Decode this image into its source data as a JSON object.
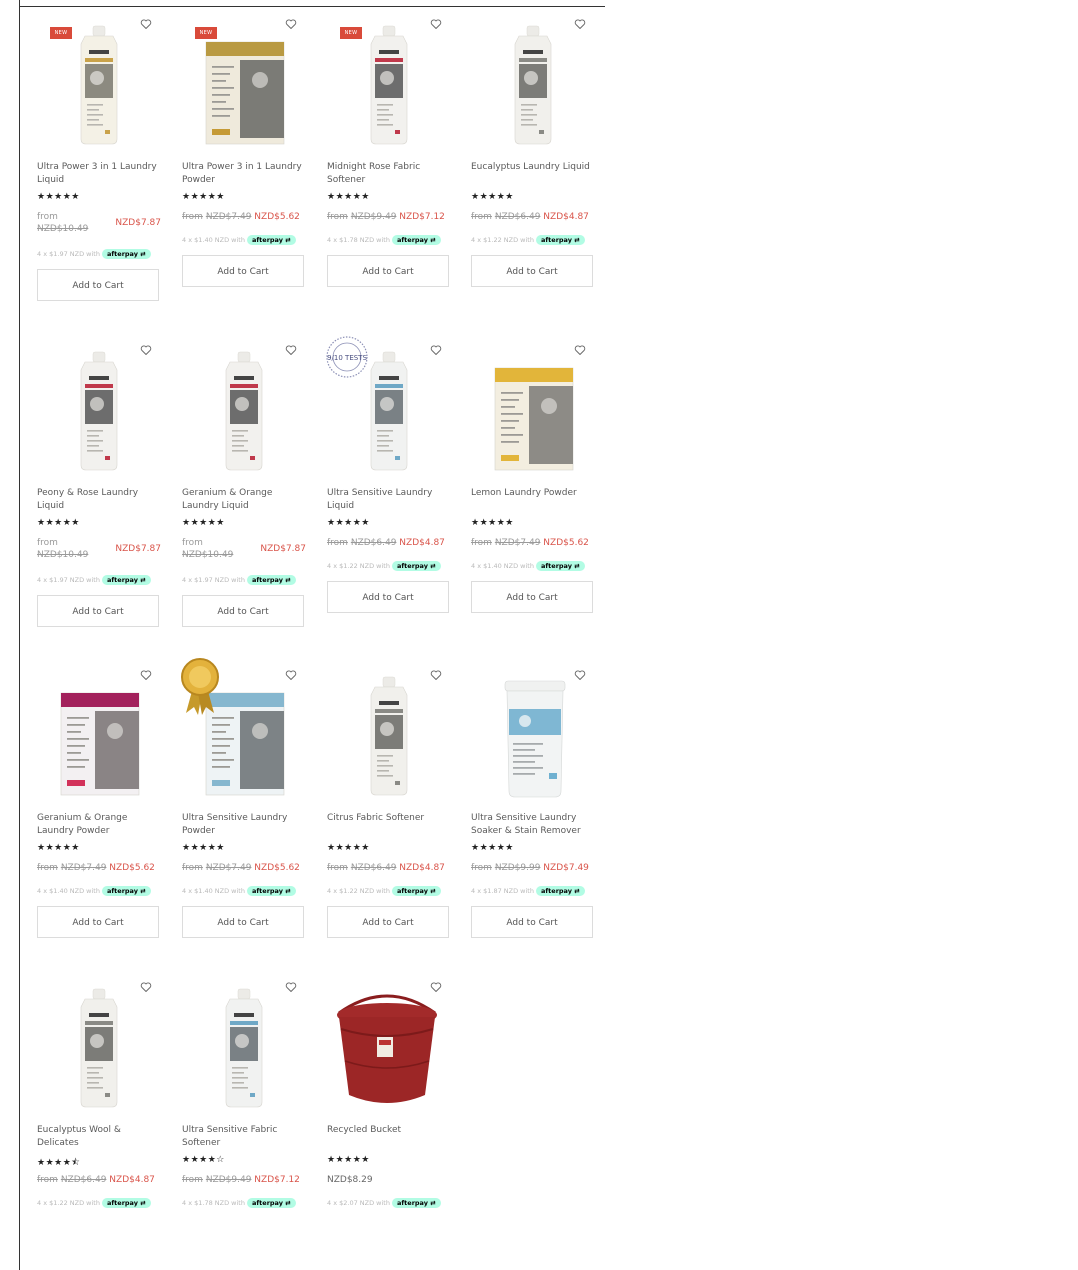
{
  "ui": {
    "add_to_cart_label": "Add to Cart",
    "new_badge": "NEW",
    "afterpay_label": "afterpay"
  },
  "products": [
    {
      "title": "Ultra Power 3 in 1 Laundry Liquid",
      "stars": "★★★★★",
      "from": "from",
      "old_price": "NZD$10.49",
      "price": "NZD$7.87",
      "installment": "4 x $1.97 NZD with",
      "new": true,
      "image": "bottle-gold",
      "price_layout": "stacked"
    },
    {
      "title": "Ultra Power 3 in 1 Laundry Powder",
      "stars": "★★★★★",
      "from": "from",
      "old_price": "NZD$7.49",
      "price": "NZD$5.62",
      "installment": "4 x $1.40 NZD with",
      "new": true,
      "image": "box-gold",
      "price_layout": "inline"
    },
    {
      "title": "Midnight Rose Fabric Softener",
      "stars": "★★★★★",
      "from": "from",
      "old_price": "NZD$9.49",
      "price": "NZD$7.12",
      "installment": "4 x $1.78 NZD with",
      "new": true,
      "image": "bottle-red",
      "price_layout": "inline"
    },
    {
      "title": "Eucalyptus Laundry Liquid",
      "stars": "★★★★★",
      "from": "from",
      "old_price": "NZD$6.49",
      "price": "NZD$4.87",
      "installment": "4 x $1.22 NZD with",
      "new": false,
      "image": "bottle-grey",
      "price_layout": "inline"
    },
    {
      "title": "Peony & Rose Laundry Liquid",
      "stars": "★★★★★",
      "from": "from",
      "old_price": "NZD$10.49",
      "price": "NZD$7.87",
      "installment": "4 x $1.97 NZD with",
      "new": false,
      "image": "bottle-red",
      "price_layout": "stacked"
    },
    {
      "title": "Geranium & Orange Laundry Liquid",
      "stars": "★★★★★",
      "from": "from",
      "old_price": "NZD$10.49",
      "price": "NZD$7.87",
      "installment": "4 x $1.97 NZD with",
      "new": false,
      "image": "bottle-red",
      "price_layout": "stacked"
    },
    {
      "title": "Ultra Sensitive Laundry Liquid",
      "stars": "★★★★★",
      "from": "from",
      "old_price": "NZD$6.49",
      "price": "NZD$4.87",
      "installment": "4 x $1.22 NZD with",
      "new": false,
      "image": "bottle-blue",
      "price_layout": "inline",
      "award": "9/10 TESTS"
    },
    {
      "title": "Lemon Laundry Powder",
      "stars": "★★★★★",
      "from": "from",
      "old_price": "NZD$7.49",
      "price": "NZD$5.62",
      "installment": "4 x $1.40 NZD with",
      "new": false,
      "image": "box-yellow",
      "price_layout": "inline"
    },
    {
      "title": "Geranium & Orange Laundry Powder",
      "stars": "★★★★★",
      "from": "from",
      "old_price": "NZD$7.49",
      "price": "NZD$5.62",
      "installment": "4 x $1.40 NZD with",
      "new": false,
      "image": "box-magenta",
      "price_layout": "inline"
    },
    {
      "title": "Ultra Sensitive Laundry Powder",
      "stars": "★★★★★",
      "from": "from",
      "old_price": "NZD$7.49",
      "price": "NZD$5.62",
      "installment": "4 x $1.40 NZD with",
      "new": false,
      "image": "box-blue",
      "price_layout": "inline",
      "medal": true
    },
    {
      "title": "Citrus Fabric Softener",
      "stars": "★★★★★",
      "from": "from",
      "old_price": "NZD$6.49",
      "price": "NZD$4.87",
      "installment": "4 x $1.22 NZD with",
      "new": false,
      "image": "bottle-grey",
      "price_layout": "inline"
    },
    {
      "title": "Ultra Sensitive Laundry Soaker & Stain Remover",
      "stars": "★★★★★",
      "from": "from",
      "old_price": "NZD$9.99",
      "price": "NZD$7.49",
      "installment": "4 x $1.87 NZD with",
      "new": false,
      "image": "tub-blue",
      "price_layout": "inline"
    },
    {
      "title": "Eucalyptus Wool & Delicates",
      "stars": "★★★★⯪",
      "from": "from",
      "old_price": "NZD$6.49",
      "price": "NZD$4.87",
      "installment": "4 x $1.22 NZD with",
      "new": false,
      "image": "bottle-grey",
      "price_layout": "inline",
      "no_button": true
    },
    {
      "title": "Ultra Sensitive Fabric Softener",
      "stars": "★★★★☆",
      "from": "from",
      "old_price": "NZD$9.49",
      "price": "NZD$7.12",
      "installment": "4 x $1.78 NZD with",
      "new": false,
      "image": "bottle-blue",
      "price_layout": "inline",
      "no_button": true
    },
    {
      "title": "Recycled Bucket",
      "stars": "★★★★★",
      "price": "NZD$8.29",
      "installment": "4 x $2.07 NZD with",
      "new": false,
      "image": "bucket",
      "price_layout": "single",
      "no_button": true
    }
  ]
}
